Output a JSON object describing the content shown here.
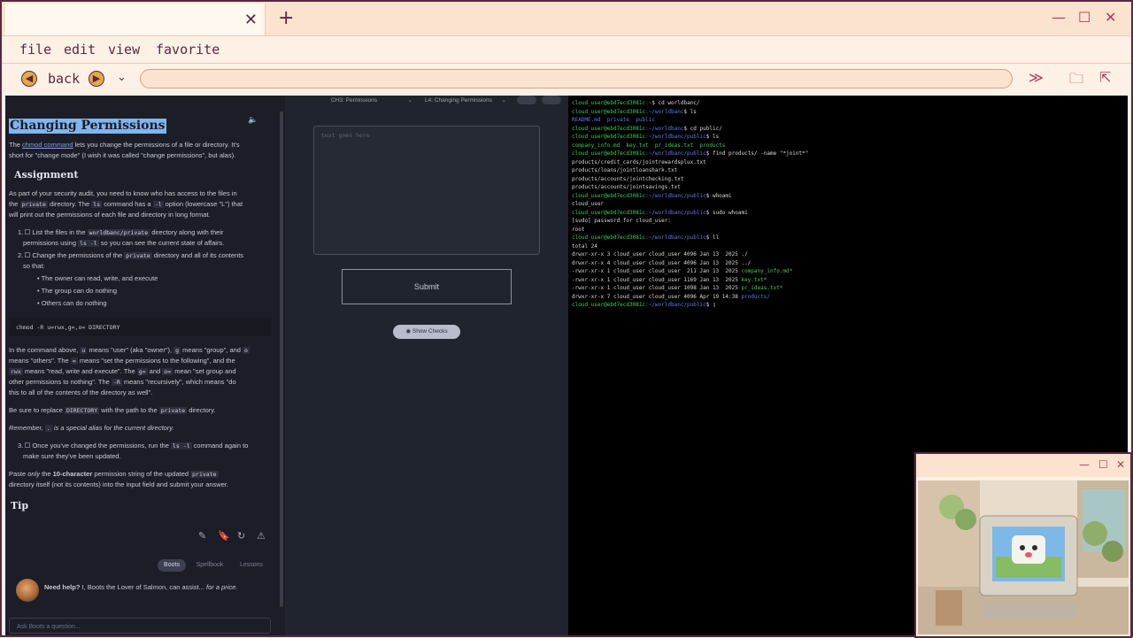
{
  "browser": {
    "window_controls": {
      "minimize": "—",
      "maximize": "☐",
      "close": "✕"
    },
    "tab_close": "✕",
    "new_tab": "+",
    "menu": [
      "file",
      "edit",
      "view",
      "favorite"
    ],
    "nav": {
      "back_label": "back",
      "forward_icon": "➔",
      "dropdown_icon": "⌄",
      "fast_forward_icon": "≫",
      "folder_icon": "🗀",
      "extension_icon": "⇱"
    },
    "accent_color": "#5a2740",
    "icon_accent": "#b23a5a"
  },
  "lesson": {
    "title": "Changing Permissions",
    "speaker_icon": "🔈",
    "intro": {
      "pre": "The ",
      "link": "chmod command",
      "post1": " lets you change the permissions of a file or directory. It's",
      "line2": "short for \"change mode\" (I wish it was called \"change permissions\", but alas)."
    },
    "assignment_heading": "Assignment",
    "assignment_lines": [
      "As part of your security audit, you need to know who has access to the files in",
      "the",
      "private",
      "directory. The",
      "ls",
      "command has a",
      "-l",
      "option (lowercase \"L\") that",
      "will print out the permissions of each file and directory in long format."
    ],
    "step1": {
      "num": "1.",
      "pre": "List the files in the ",
      "code": "worldbanc/private",
      "post": " directory along with their",
      "line2pre": "permissions using ",
      "code2": "ls -l",
      "line2post": " so you can see the current state of affairs."
    },
    "step2": {
      "num": "2.",
      "pre": "Change the permissions of the ",
      "code": "private",
      "post": " directory and all of its contents",
      "line2": "so that:"
    },
    "bullets": [
      "The owner can read, write, and execute",
      "The group can do nothing",
      "Others can do nothing"
    ],
    "command": "chmod -R u=rwx,g=,o= DIRECTORY",
    "explain": {
      "l1a": "In the command above, ",
      "u": "u",
      "l1b": " means \"user\" (aka \"owner\"), ",
      "g": "g",
      "l1c": " means \"group\", and ",
      "o": "o",
      "l2a": "means \"others\". The ",
      "eq": "=",
      "l2b": " means \"set the permissions to the following\", and the",
      "rwx": "rwx",
      "l3a": " means \"read, write and execute\". The ",
      "geq": "g=",
      "and": " and ",
      "oeq": "o=",
      "l3b": " mean \"set group and",
      "l4a": "other permissions to nothing\". The ",
      "R": "-R",
      "l4b": " means \"recursively\", which means \"do",
      "l5": "this to all of the contents of the directory as well\"."
    },
    "replace": {
      "pre": "Be sure to replace ",
      "code1": "DIRECTORY",
      "mid": " with the path to the ",
      "code2": "private",
      "post": " directory."
    },
    "remember": {
      "pre": "Remember, ",
      "code": ".",
      "post": " is a special alias for the current directory."
    },
    "step3": {
      "num": "3.",
      "pre": "Once you've changed the permissions, run the ",
      "code": "ls -l",
      "post": " command again to",
      "line2": "make sure they've been updated."
    },
    "paste": {
      "pre": "Paste ",
      "only": "only",
      "mid": " the ",
      "bold": "10-character",
      "post": " permission string of the updated ",
      "code": "private",
      "line2": "directory itself (not its contents) into the input field and submit your answer."
    },
    "tip_heading": "Tip",
    "action_icons": [
      "✎",
      "🔖",
      "↻",
      "⚠"
    ],
    "assistant_tabs": [
      "Boots",
      "Spellbook",
      "Lessons"
    ],
    "help": {
      "bold": "Need help?",
      "text": " I, Boots the Lover of Salmon, can assist... ",
      "italic": "for a price."
    },
    "ask_placeholder": "Ask Boots a question..."
  },
  "exercise": {
    "chapter_select": "CH3: Permissions",
    "lesson_select": "L4: Changing Permissions",
    "textarea_placeholder": "text goes here",
    "submit_label": "Submit",
    "show_checks_label": "Show Checks"
  },
  "terminal": {
    "host": "cloud_user@ebd7ecd3081c",
    "lines": [
      {
        "prompt": "cloud_user@ebd7ecd3081c",
        "path": ":~",
        "cmd": "$ cd worldbanc/"
      },
      {
        "prompt": "cloud_user@ebd7ecd3081c",
        "path": ":~/worldbanc",
        "cmd": "$ ls"
      },
      {
        "out_dirs": "README.md  private  public"
      },
      {
        "prompt": "cloud_user@ebd7ecd3081c",
        "path": ":~/worldbanc",
        "cmd": "$ cd public/"
      },
      {
        "prompt": "cloud_user@ebd7ecd3081c",
        "path": ":~/worldbanc/public",
        "cmd": "$ ls"
      },
      {
        "out_files": "company_info.md  key.txt  pr_ideas.txt  products"
      },
      {
        "prompt": "cloud_user@ebd7ecd3081c",
        "path": ":~/worldbanc/public",
        "cmd": "$ find products/ -name \"*joint*\""
      },
      {
        "out": "products/credit_cards/jointrewardsplux.txt"
      },
      {
        "out": "products/loans/jointloanshark.txt"
      },
      {
        "out": "products/accounts/jointchecking.txt"
      },
      {
        "out": "products/accounts/jointsavings.txt"
      },
      {
        "prompt": "cloud_user@ebd7ecd3081c",
        "path": ":~/worldbanc/public",
        "cmd": "$ whoami"
      },
      {
        "out": "cloud_user"
      },
      {
        "prompt": "cloud_user@ebd7ecd3081c",
        "path": ":~/worldbanc/public",
        "cmd": "$ sudo whoami"
      },
      {
        "out": "[sudo] password for cloud_user:"
      },
      {
        "out": "root"
      },
      {
        "prompt": "cloud_user@ebd7ecd3081c",
        "path": ":~/worldbanc/public",
        "cmd": "$ ll"
      },
      {
        "out": "total 24"
      },
      {
        "ls_pre": "drwxr-xr-x 3 cloud_user cloud_user 4096 Jan 13  2025 ",
        "ls_name": "./",
        "ls_type": "plain"
      },
      {
        "ls_pre": "drwxr-xr-x 4 cloud_user cloud_user 4096 Jan 13  2025 ",
        "ls_name": "../",
        "ls_type": "plain"
      },
      {
        "ls_pre": "-rwxr-xr-x 1 cloud_user cloud_user  211 Jan 13  2025 ",
        "ls_name": "company_info.md*",
        "ls_type": "exe"
      },
      {
        "ls_pre": "-rwxr-xr-x 1 cloud_user cloud_user 1169 Jan 13  2025 ",
        "ls_name": "key.txt*",
        "ls_type": "exe"
      },
      {
        "ls_pre": "-rwxr-xr-x 1 cloud_user cloud_user 1098 Jan 13  2025 ",
        "ls_name": "pr_ideas.txt*",
        "ls_type": "exe"
      },
      {
        "ls_pre": "drwxr-xr-x 7 cloud_user cloud_user 4096 Apr 19 14:38 ",
        "ls_name": "products/",
        "ls_type": "dir"
      },
      {
        "prompt": "cloud_user@ebd7ecd3081c",
        "path": ":~/worldbanc/public",
        "cmd": "$ "
      }
    ]
  },
  "pip": {
    "controls": {
      "minimize": "—",
      "maximize": "☐",
      "close": "✕"
    }
  }
}
